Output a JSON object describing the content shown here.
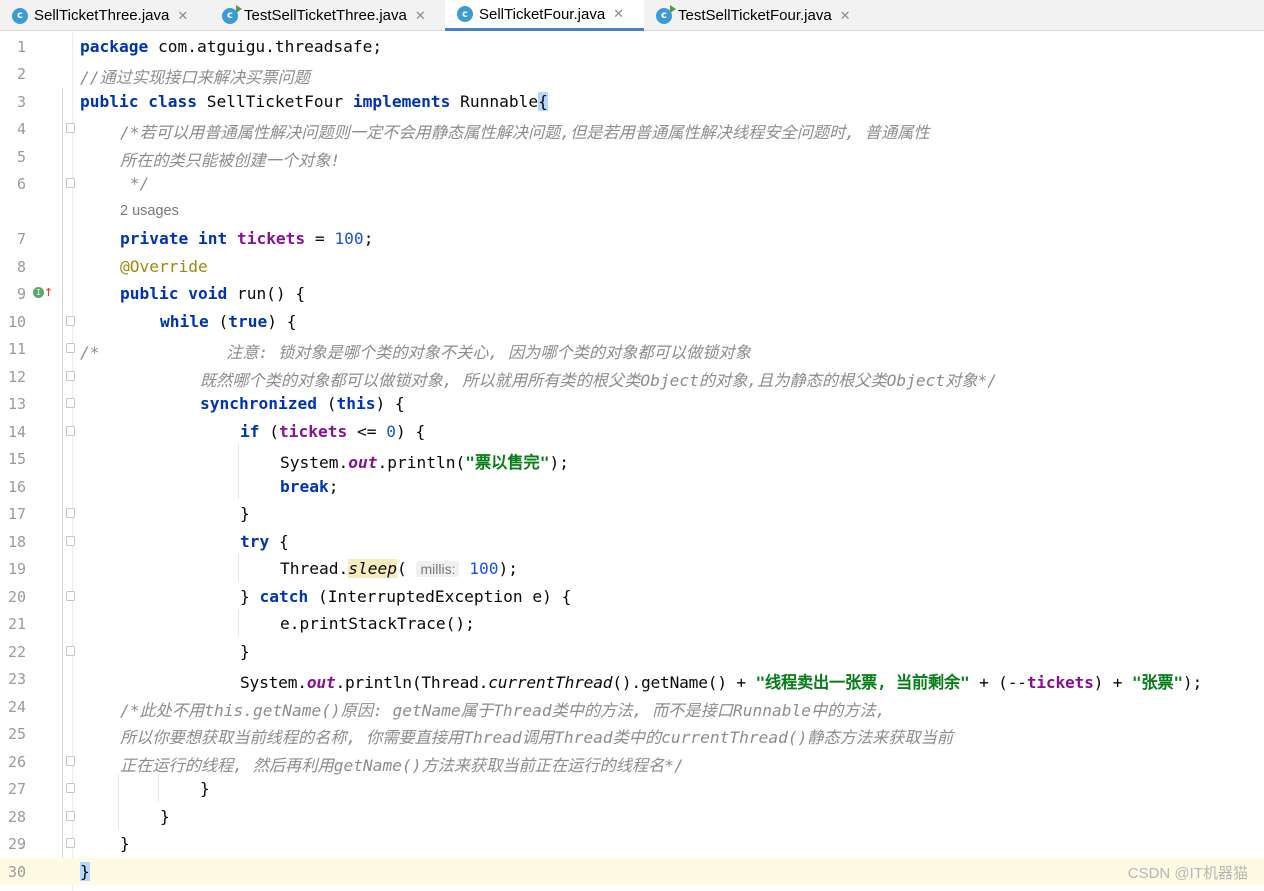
{
  "tabs": [
    {
      "label": "SellTicketThree.java",
      "icon": "class-icon",
      "active": false
    },
    {
      "label": "TestSellTicketThree.java",
      "icon": "runnable-class-icon",
      "active": false
    },
    {
      "label": "SellTicketFour.java",
      "icon": "class-icon",
      "active": true
    },
    {
      "label": "TestSellTicketFour.java",
      "icon": "runnable-class-icon",
      "active": false
    }
  ],
  "tab_close_glyph": "✕",
  "code_lines": [
    {
      "n": "1"
    },
    {
      "n": "2"
    },
    {
      "n": "3"
    },
    {
      "n": "4"
    },
    {
      "n": "5"
    },
    {
      "n": "6"
    },
    {
      "usages": "2 usages"
    },
    {
      "n": "7"
    },
    {
      "n": "8"
    },
    {
      "n": "9"
    },
    {
      "n": "10"
    },
    {
      "n": "11"
    },
    {
      "n": "12"
    },
    {
      "n": "13"
    },
    {
      "n": "14"
    },
    {
      "n": "15"
    },
    {
      "n": "16"
    },
    {
      "n": "17"
    },
    {
      "n": "18"
    },
    {
      "n": "19"
    },
    {
      "n": "20"
    },
    {
      "n": "21"
    },
    {
      "n": "22"
    },
    {
      "n": "23"
    },
    {
      "n": "24"
    },
    {
      "n": "25"
    },
    {
      "n": "26"
    },
    {
      "n": "27"
    },
    {
      "n": "28"
    },
    {
      "n": "29"
    },
    {
      "n": "30"
    }
  ],
  "code": {
    "l1_kw": "package",
    "l1_rest": " com.atguigu.threadsafe;",
    "l2": "//通过实现接口来解决买票问题",
    "l3_a": "public class",
    "l3_b": " SellTicketFour ",
    "l3_c": "implements",
    "l3_d": " Runnable",
    "l3_e": "{",
    "l4": "/*若可以用普通属性解决问题则一定不会用静态属性解决问题,但是若用普通属性解决线程安全问题时, 普通属性",
    "l5": "所在的类只能被创建一个对象!",
    "l6": " */",
    "l7_a": "private int",
    "l7_b": "tickets",
    "l7_c": " = ",
    "l7_d": "100",
    "l7_e": ";",
    "l8": "@Override",
    "l9_a": "public void",
    "l9_b": " run() {",
    "l10_a": "while",
    "l10_b": " (",
    "l10_c": "true",
    "l10_d": ") {",
    "l11": "/*             注意: 锁对象是哪个类的对象不关心, 因为哪个类的对象都可以做锁对象",
    "l12": "既然哪个类的对象都可以做锁对象, 所以就用所有类的根父类Object的对象,且为静态的根父类Object对象*/",
    "l13_a": "synchronized",
    "l13_b": " (",
    "l13_c": "this",
    "l13_d": ") {",
    "l14_a": "if",
    "l14_b": " (",
    "l14_c": "tickets",
    "l14_d": " <= ",
    "l14_e": "0",
    "l14_f": ") {",
    "l15_a": "System.",
    "l15_b": "out",
    "l15_c": ".println(",
    "l15_d": "\"票以售完\"",
    "l15_e": ");",
    "l16_a": "break",
    "l16_b": ";",
    "l17": "}",
    "l18_a": "try",
    "l18_b": " {",
    "l19_a": "Thread.",
    "l19_b": "sleep",
    "l19_c": "(",
    "l19_hint": "millis:",
    "l19_d": "100",
    "l19_e": ");",
    "l20_a": "} ",
    "l20_b": "catch",
    "l20_c": " (InterruptedException e) {",
    "l21": "e.printStackTrace();",
    "l22": "}",
    "l23_a": "System.",
    "l23_b": "out",
    "l23_c": ".println(Thread.",
    "l23_d": "currentThread",
    "l23_e": "().getName() + ",
    "l23_f": "\"线程卖出一张票, 当前剩余\"",
    "l23_g": " + (--",
    "l23_h": "tickets",
    "l23_i": ") + ",
    "l23_j": "\"张票\"",
    "l23_k": ");",
    "l24": "/*此处不用this.getName()原因: getName属于Thread类中的方法, 而不是接口Runnable中的方法,",
    "l25": "所以你要想获取当前线程的名称, 你需要直接用Thread调用Thread类中的currentThread()静态方法来获取当前",
    "l26": "正在运行的线程, 然后再利用getName()方法来获取当前正在运行的线程名*/",
    "l27": "}",
    "l28": "}",
    "l29": "}",
    "l30": "}"
  },
  "watermark": "CSDN @IT机器猫"
}
